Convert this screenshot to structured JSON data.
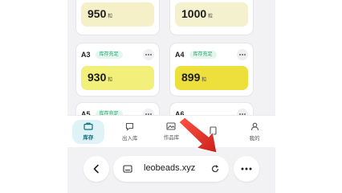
{
  "cards": [
    {
      "code": "",
      "badge": "",
      "count": "950",
      "unit": "粒"
    },
    {
      "code": "",
      "badge": "",
      "count": "1000",
      "unit": "粒"
    },
    {
      "code": "A3",
      "badge": "库存充足",
      "count": "930",
      "unit": "粒"
    },
    {
      "code": "A4",
      "badge": "库存充足",
      "count": "899",
      "unit": "粒"
    },
    {
      "code": "A5",
      "badge": "库存充足"
    },
    {
      "code": "A6",
      "badge": ""
    }
  ],
  "tabs": [
    {
      "label": "库存",
      "icon": "inventory-icon"
    },
    {
      "label": "出入库",
      "icon": "stock-io-icon"
    },
    {
      "label": "作品库",
      "icon": "gallery-icon"
    },
    {
      "label": "",
      "icon": "obscured-icon"
    },
    {
      "label": "我的",
      "icon": "profile-icon"
    }
  ],
  "browser": {
    "url": "leobeads.xyz"
  },
  "colors": {
    "accent": "#0f6f7c",
    "badge_green": "#1aa36a",
    "arrow_red": "#e0201b"
  }
}
